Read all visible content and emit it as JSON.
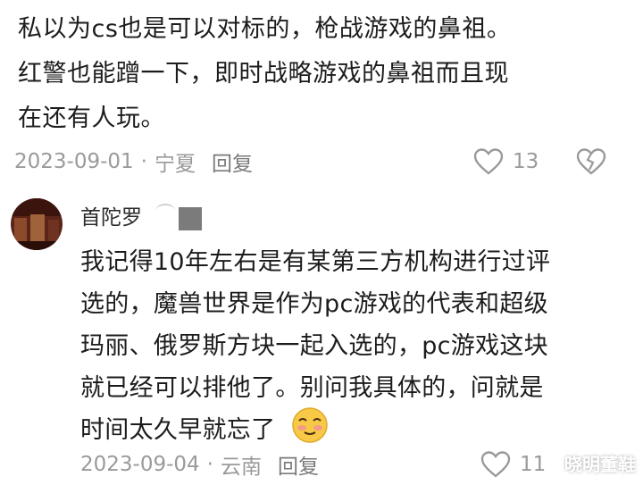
{
  "top_comment": {
    "text": "私以为cs也是可以对标的，枪战游戏的鼻祖。\n红警也能蹭一下，即时战略游戏的鼻祖而且现\n在还有人玩。",
    "date": "2023-09-01",
    "separator": "·",
    "location": "宁夏",
    "reply_label": "回复",
    "like_count": "13"
  },
  "reply_comment": {
    "username": "首陀罗",
    "text": "我记得10年左右是有某第三方机构进行过评\n选的，魔兽世界是作为pc游戏的代表和超级\n玛丽、俄罗斯方块一起入选的，pc游戏这块\n就已经可以排他了。别问我具体的，问就是\n时间太久早就忘了",
    "date": "2023-09-04",
    "separator": "·",
    "location": "云南",
    "reply_label": "回复",
    "like_count": "11"
  },
  "watermark": "晓明董鞋",
  "icons": {
    "like": "heart-outline-icon",
    "dislike": "broken-heart-icon",
    "emoji": "shy-smile-emoji-icon"
  },
  "colors": {
    "meta_gray": "#9a9a9a",
    "text": "#1c1c1c",
    "emoji_yellow": "#f7c947"
  }
}
